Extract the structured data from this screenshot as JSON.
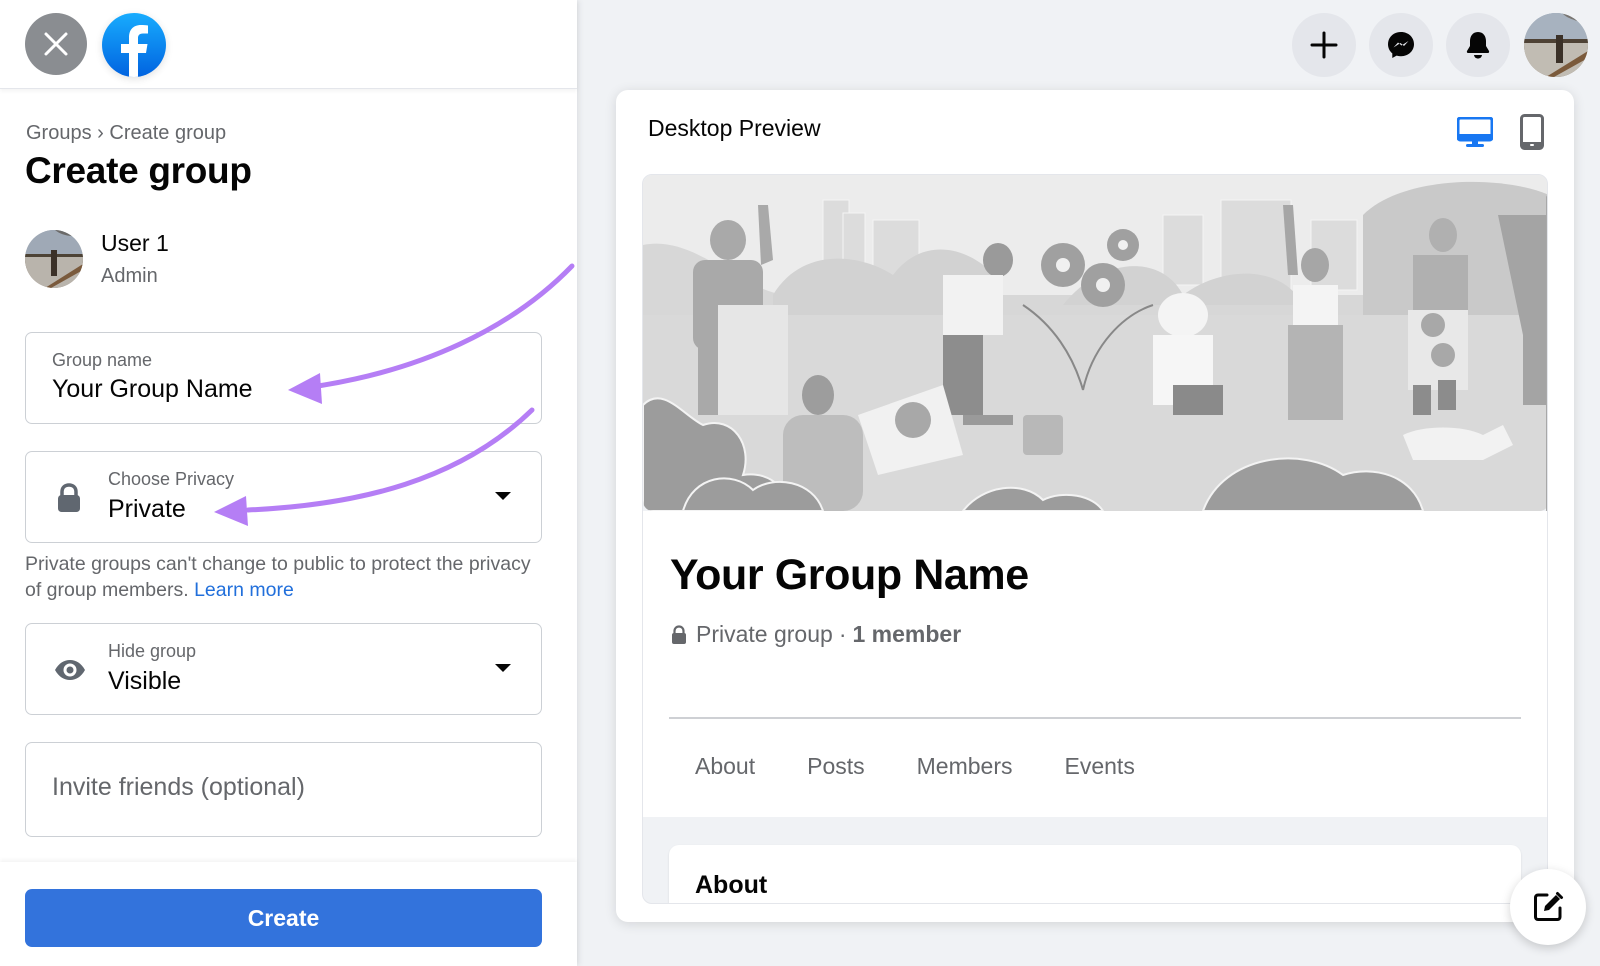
{
  "left_panel": {
    "close_icon": "close-icon",
    "logo": "facebook-logo",
    "breadcrumb": {
      "items": [
        "Groups",
        "Create group"
      ],
      "separator": "›",
      "text": "Groups › Create group"
    },
    "title": "Create group",
    "user": {
      "name": "User 1",
      "role": "Admin"
    },
    "group_name_field": {
      "label": "Group name",
      "value": "Your Group Name"
    },
    "privacy_field": {
      "label": "Choose Privacy",
      "value": "Private",
      "icon": "lock-icon"
    },
    "privacy_note": "Private groups can't change to public to protect the privacy of group members.",
    "learn_more_label": "Learn more",
    "hide_field": {
      "label": "Hide group",
      "value": "Visible",
      "icon": "eye-icon"
    },
    "invite_field": {
      "placeholder": "Invite friends (optional)",
      "value": ""
    },
    "create_button": "Create"
  },
  "top_nav": {
    "buttons": [
      {
        "name": "create",
        "icon": "plus-icon"
      },
      {
        "name": "messenger",
        "icon": "messenger-icon"
      },
      {
        "name": "notifications",
        "icon": "bell-icon"
      },
      {
        "name": "account",
        "icon": "avatar"
      }
    ]
  },
  "preview": {
    "title": "Desktop Preview",
    "device_toggle": {
      "selected": "desktop",
      "options": [
        "desktop",
        "mobile"
      ]
    },
    "group_name": "Your Group Name",
    "privacy_text": "Private group",
    "separator": "·",
    "member_count": "1 member",
    "tabs": [
      "About",
      "Posts",
      "Members",
      "Events"
    ],
    "about_heading": "About"
  },
  "colors": {
    "primary_button": "#3373dc",
    "link": "#216fdb",
    "active_device": "#1877f2",
    "annotation_arrow": "#b57ef5",
    "secondary_text": "#65676b",
    "page_bg": "#f0f2f5"
  }
}
